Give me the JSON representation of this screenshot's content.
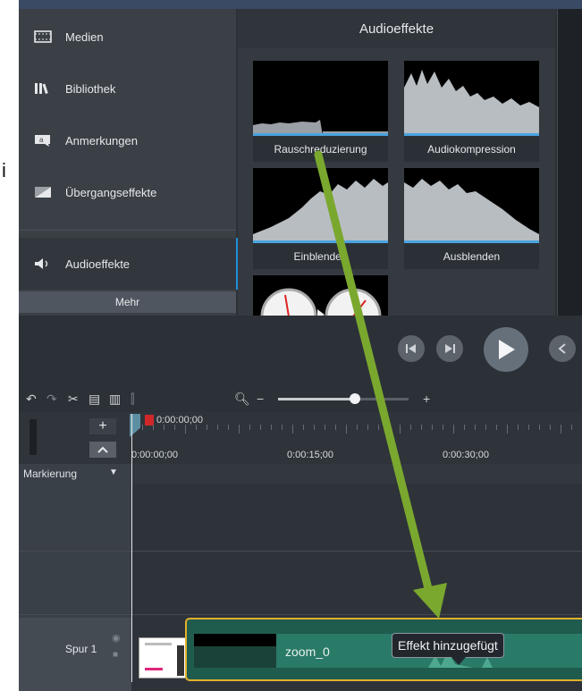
{
  "page_fragment": "i",
  "sidebar": {
    "items": [
      {
        "label": "Medien"
      },
      {
        "label": "Bibliothek"
      },
      {
        "label": "Anmerkungen"
      },
      {
        "label": "Übergangseffekte"
      },
      {
        "label": "Audioeffekte"
      }
    ],
    "more_label": "Mehr"
  },
  "gallery": {
    "title": "Audioeffekte",
    "tiles": [
      {
        "label": "Rauschreduzierung"
      },
      {
        "label": "Audiokompression"
      },
      {
        "label": "Einblenden"
      },
      {
        "label": "Ausblenden"
      },
      {
        "label": ""
      }
    ]
  },
  "timeline": {
    "playhead_time": "0:00:00;00",
    "ruler_labels": [
      "0:00:00;00",
      "0:00:15;00",
      "0:00:30;00"
    ],
    "marker_label": "Markierung",
    "track_label": "Spur 1",
    "clip_label": "zoom_0",
    "tooltip": "Effekt hinzugefügt"
  },
  "colors": {
    "accent_blue": "#1f8fd8",
    "clip_border": "#e1b12c",
    "arrow_green": "#7aa82e"
  }
}
